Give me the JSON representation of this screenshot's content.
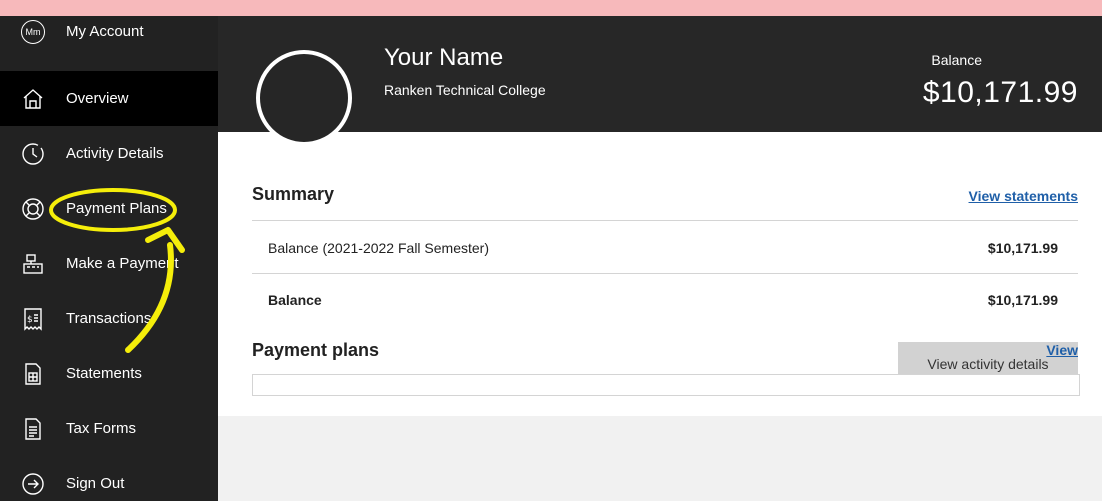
{
  "sidebar": {
    "items": [
      {
        "label": "My Account",
        "icon": "mm-monogram-icon"
      },
      {
        "label": "Overview",
        "icon": "home-icon"
      },
      {
        "label": "Activity Details",
        "icon": "clock-icon"
      },
      {
        "label": "Payment Plans",
        "icon": "lifebuoy-icon"
      },
      {
        "label": "Make a Payment",
        "icon": "register-icon"
      },
      {
        "label": "Transactions",
        "icon": "receipt-icon"
      },
      {
        "label": "Statements",
        "icon": "statement-icon"
      },
      {
        "label": "Tax Forms",
        "icon": "tax-forms-icon"
      },
      {
        "label": "Sign Out",
        "icon": "sign-out-icon"
      }
    ],
    "monogram": "Mm"
  },
  "profile": {
    "name": "Your Name",
    "school": "Ranken Technical College",
    "balance_label": "Balance",
    "balance_amount": "$10,171.99"
  },
  "summary": {
    "title": "Summary",
    "view_statements": "View statements",
    "rows": [
      {
        "label": "Balance (2021-2022 Fall Semester)",
        "value": "$10,171.99"
      },
      {
        "label": "Balance",
        "value": "$10,171.99"
      }
    ],
    "button": "View activity details"
  },
  "payment_plans": {
    "title": "Payment plans",
    "view": "View"
  },
  "colors": {
    "page_bg": "#f7b9bb",
    "sidebar": "#222222",
    "annotation": "#f5ee0a",
    "link": "#1f5fa8"
  }
}
